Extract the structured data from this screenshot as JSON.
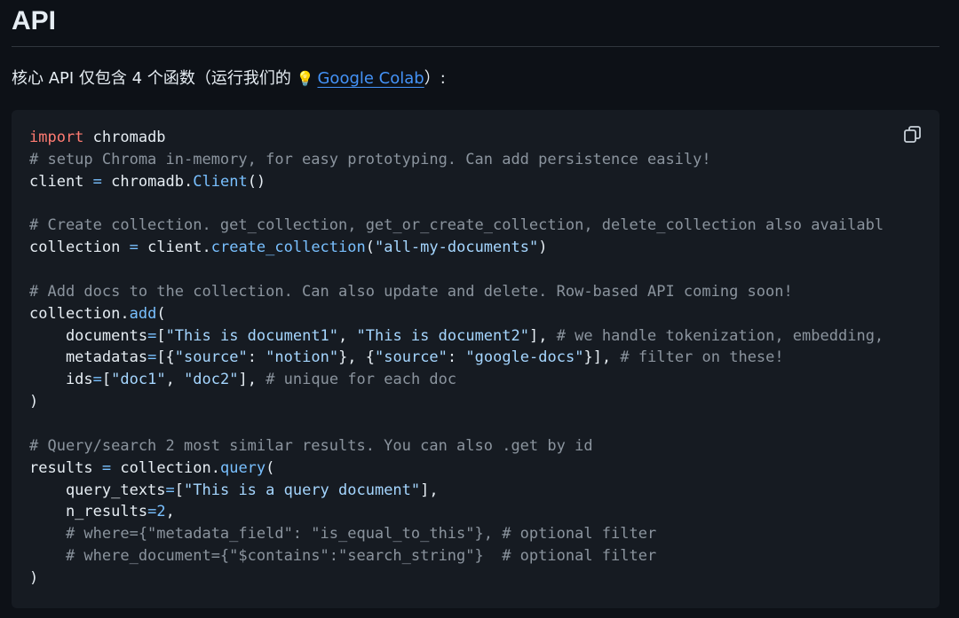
{
  "section": {
    "title": "API",
    "intro_prefix": "核心 API 仅包含 4 个函数（运行我们的",
    "link_icon": "💡",
    "link_text": "Google Colab",
    "intro_suffix": "）:"
  },
  "code_block": {
    "copy_icon": "copy-icon",
    "colors": {
      "keyword": "#ff7b72",
      "comment": "#8b949e",
      "function": "#79c0ff",
      "string": "#a5d6ff",
      "background": "#161b22"
    },
    "tokens": {
      "l1_kw": "import",
      "l1_rest": " chromadb",
      "l2_cm": "# setup Chroma in-memory, for easy prototyping. Can add persistence easily!",
      "l3_a": "client ",
      "l3_op": "=",
      "l3_b": " chromadb.",
      "l3_fn": "Client",
      "l3_c": "()",
      "l5_cm": "# Create collection. get_collection, get_or_create_collection, delete_collection also availabl",
      "l6_a": "collection ",
      "l6_op": "=",
      "l6_b": " client.",
      "l6_fn": "create_collection",
      "l6_c": "(",
      "l6_str": "\"all-my-documents\"",
      "l6_d": ")",
      "l8_cm": "# Add docs to the collection. Can also update and delete. Row-based API coming soon!",
      "l9_a": "collection.",
      "l9_fn": "add",
      "l9_b": "(",
      "l10_a": "    documents",
      "l10_op": "=",
      "l10_b": "[",
      "l10_s1": "\"This is document1\"",
      "l10_c": ", ",
      "l10_s2": "\"This is document2\"",
      "l10_d": "], ",
      "l10_cm": "# we handle tokenization, embedding,",
      "l11_a": "    metadatas",
      "l11_op": "=",
      "l11_b": "[{",
      "l11_s1": "\"source\"",
      "l11_c": ": ",
      "l11_s2": "\"notion\"",
      "l11_d": "}, {",
      "l11_s3": "\"source\"",
      "l11_e": ": ",
      "l11_s4": "\"google-docs\"",
      "l11_f": "}], ",
      "l11_cm": "# filter on these!",
      "l12_a": "    ids",
      "l12_op": "=",
      "l12_b": "[",
      "l12_s1": "\"doc1\"",
      "l12_c": ", ",
      "l12_s2": "\"doc2\"",
      "l12_d": "], ",
      "l12_cm": "# unique for each doc",
      "l13": ")",
      "l15_cm": "# Query/search 2 most similar results. You can also .get by id",
      "l16_a": "results ",
      "l16_op": "=",
      "l16_b": " collection.",
      "l16_fn": "query",
      "l16_c": "(",
      "l17_a": "    query_texts",
      "l17_op": "=",
      "l17_b": "[",
      "l17_s": "\"This is a query document\"",
      "l17_c": "],",
      "l18_a": "    n_results",
      "l18_op": "=",
      "l18_num": "2",
      "l18_b": ",",
      "l19_cm": "    # where={\"metadata_field\": \"is_equal_to_this\"}, # optional filter",
      "l20_cm": "    # where_document={\"$contains\":\"search_string\"}  # optional filter",
      "l21": ")"
    }
  }
}
